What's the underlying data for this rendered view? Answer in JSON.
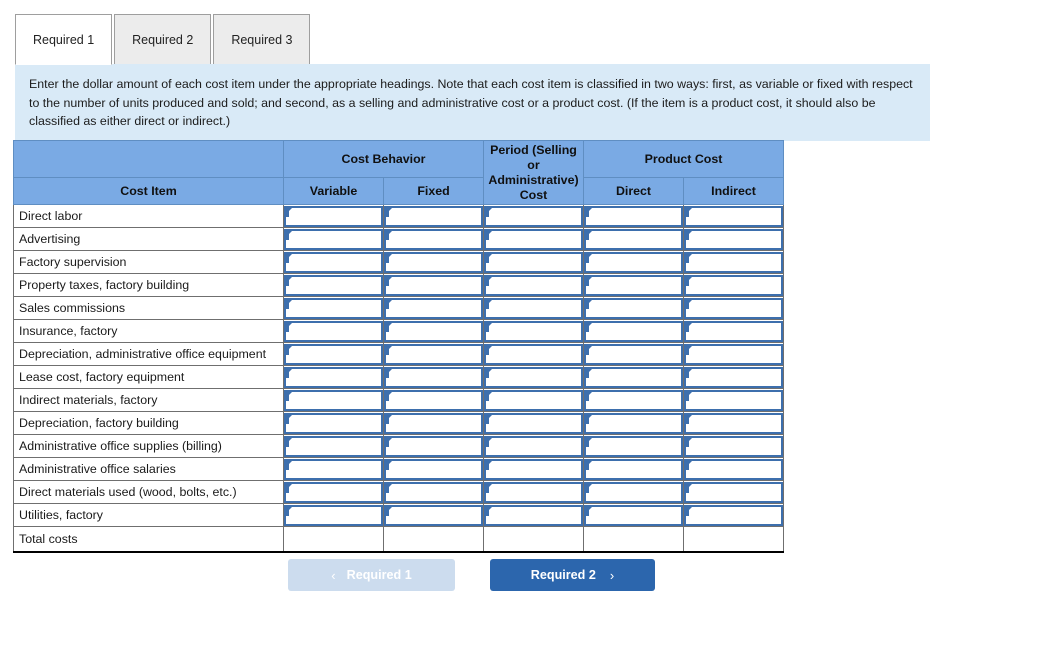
{
  "tabs": [
    {
      "label": "Required 1",
      "active": true
    },
    {
      "label": "Required 2",
      "active": false
    },
    {
      "label": "Required 3",
      "active": false
    }
  ],
  "instructions": {
    "text": "Enter the dollar amount of each cost item under the appropriate headings. Note that each cost item is classified in two ways: first, as variable or fixed with respect to the number of units produced and sold; and second, as a selling and administrative cost or a product cost. (If the item is a product cost, it should also be classified as either direct or indirect.)"
  },
  "table": {
    "group_headers": {
      "cost_behavior": "Cost Behavior",
      "period_cost": "Period (Selling or Administrative) Cost",
      "product_cost": "Product Cost"
    },
    "columns": [
      "Cost Item",
      "Variable",
      "Fixed",
      "Period (Selling or Administrative) Cost",
      "Direct",
      "Indirect"
    ],
    "sub_headers": {
      "cost_item": "Cost Item",
      "variable": "Variable",
      "fixed": "Fixed",
      "direct": "Direct",
      "indirect": "Indirect"
    },
    "rows": [
      {
        "label": "Direct labor",
        "variable": "",
        "fixed": "",
        "period": "",
        "direct": "",
        "indirect": ""
      },
      {
        "label": "Advertising",
        "variable": "",
        "fixed": "",
        "period": "",
        "direct": "",
        "indirect": ""
      },
      {
        "label": "Factory supervision",
        "variable": "",
        "fixed": "",
        "period": "",
        "direct": "",
        "indirect": ""
      },
      {
        "label": "Property taxes, factory building",
        "variable": "",
        "fixed": "",
        "period": "",
        "direct": "",
        "indirect": ""
      },
      {
        "label": "Sales commissions",
        "variable": "",
        "fixed": "",
        "period": "",
        "direct": "",
        "indirect": ""
      },
      {
        "label": "Insurance, factory",
        "variable": "",
        "fixed": "",
        "period": "",
        "direct": "",
        "indirect": ""
      },
      {
        "label": "Depreciation, administrative office equipment",
        "variable": "",
        "fixed": "",
        "period": "",
        "direct": "",
        "indirect": ""
      },
      {
        "label": "Lease cost, factory equipment",
        "variable": "",
        "fixed": "",
        "period": "",
        "direct": "",
        "indirect": ""
      },
      {
        "label": "Indirect materials, factory",
        "variable": "",
        "fixed": "",
        "period": "",
        "direct": "",
        "indirect": ""
      },
      {
        "label": "Depreciation, factory building",
        "variable": "",
        "fixed": "",
        "period": "",
        "direct": "",
        "indirect": ""
      },
      {
        "label": "Administrative office supplies (billing)",
        "variable": "",
        "fixed": "",
        "period": "",
        "direct": "",
        "indirect": ""
      },
      {
        "label": "Administrative office salaries",
        "variable": "",
        "fixed": "",
        "period": "",
        "direct": "",
        "indirect": ""
      },
      {
        "label": "Direct materials used (wood, bolts, etc.)",
        "variable": "",
        "fixed": "",
        "period": "",
        "direct": "",
        "indirect": ""
      },
      {
        "label": "Utilities, factory",
        "variable": "",
        "fixed": "",
        "period": "",
        "direct": "",
        "indirect": ""
      }
    ],
    "total_row": {
      "label": "Total costs",
      "variable": "",
      "fixed": "",
      "period": "",
      "direct": "",
      "indirect": ""
    }
  },
  "navigation": {
    "prev_label": "Required 1",
    "prev_icon": "chevron-left-icon",
    "prev_chevron": "‹",
    "prev_disabled": true,
    "next_label": "Required 2",
    "next_icon": "chevron-right-icon",
    "next_chevron": "›",
    "next_disabled": false
  },
  "colors": {
    "header_blue": "#7aaae4",
    "banner_blue": "#d9eaf7",
    "input_border": "#3d6fad",
    "button_active": "#2c66ad",
    "button_disabled": "#ccdcee"
  }
}
